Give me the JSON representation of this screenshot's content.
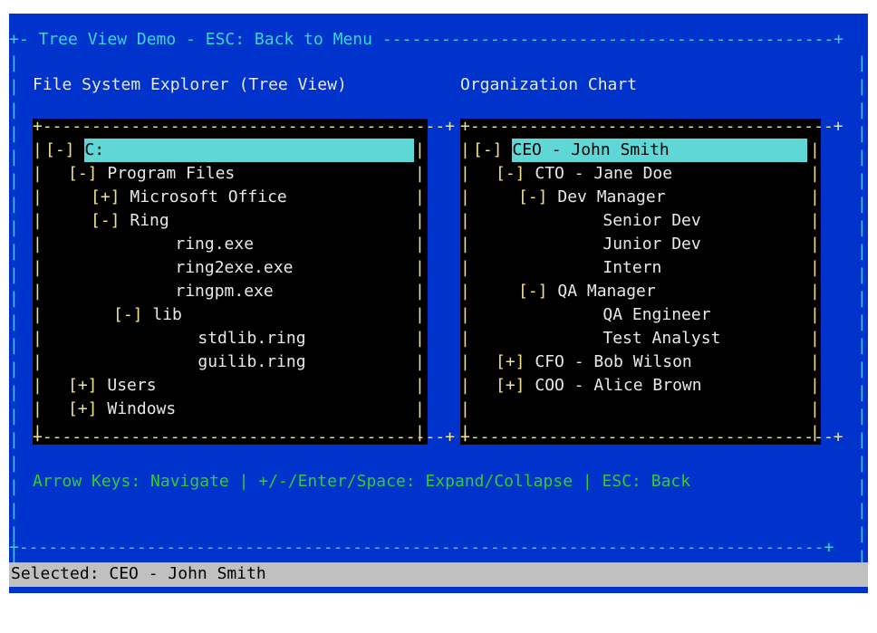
{
  "window": {
    "title": "+- Tree View Demo - ESC: Back to Menu ----------------------------------------------+"
  },
  "file_panel": {
    "heading": "File System Explorer (Tree View)",
    "nodes": [
      {
        "toggle": "[-]",
        "label": "C:",
        "selected": true
      },
      {
        "toggle": "[-]",
        "label": "Program Files"
      },
      {
        "toggle": "[+]",
        "label": "Microsoft Office"
      },
      {
        "toggle": "[-]",
        "label": "Ring"
      },
      {
        "toggle": "",
        "label": "ring.exe"
      },
      {
        "toggle": "",
        "label": "ring2exe.exe"
      },
      {
        "toggle": "",
        "label": "ringpm.exe"
      },
      {
        "toggle": "[-]",
        "label": "lib"
      },
      {
        "toggle": "",
        "label": "stdlib.ring"
      },
      {
        "toggle": "",
        "label": "guilib.ring"
      },
      {
        "toggle": "[+]",
        "label": "Users"
      },
      {
        "toggle": "[+]",
        "label": "Windows"
      }
    ]
  },
  "org_panel": {
    "heading": "Organization Chart",
    "nodes": [
      {
        "toggle": "[-]",
        "label": "CEO - John Smith",
        "selected": true
      },
      {
        "toggle": "[-]",
        "label": "CTO - Jane Doe"
      },
      {
        "toggle": "[-]",
        "label": "Dev Manager"
      },
      {
        "toggle": "",
        "label": "Senior Dev"
      },
      {
        "toggle": "",
        "label": "Junior Dev"
      },
      {
        "toggle": "",
        "label": "Intern"
      },
      {
        "toggle": "[-]",
        "label": "QA Manager"
      },
      {
        "toggle": "",
        "label": "QA Engineer"
      },
      {
        "toggle": "",
        "label": "Test Analyst"
      },
      {
        "toggle": "[+]",
        "label": "CFO - Bob Wilson"
      },
      {
        "toggle": "[+]",
        "label": "COO - Alice Brown"
      }
    ]
  },
  "help_text": "Arrow Keys: Navigate | +/-/Enter/Space: Expand/Collapse | ESC: Back",
  "status_bar": {
    "text": "Selected: CEO - John Smith"
  },
  "colors": {
    "background": "#0033cc",
    "border": "#38d6d6",
    "toggle": "#f2e28c",
    "selection": "#5fd7d7",
    "help": "#33cc33",
    "status_bar": "#c0c0c0"
  }
}
